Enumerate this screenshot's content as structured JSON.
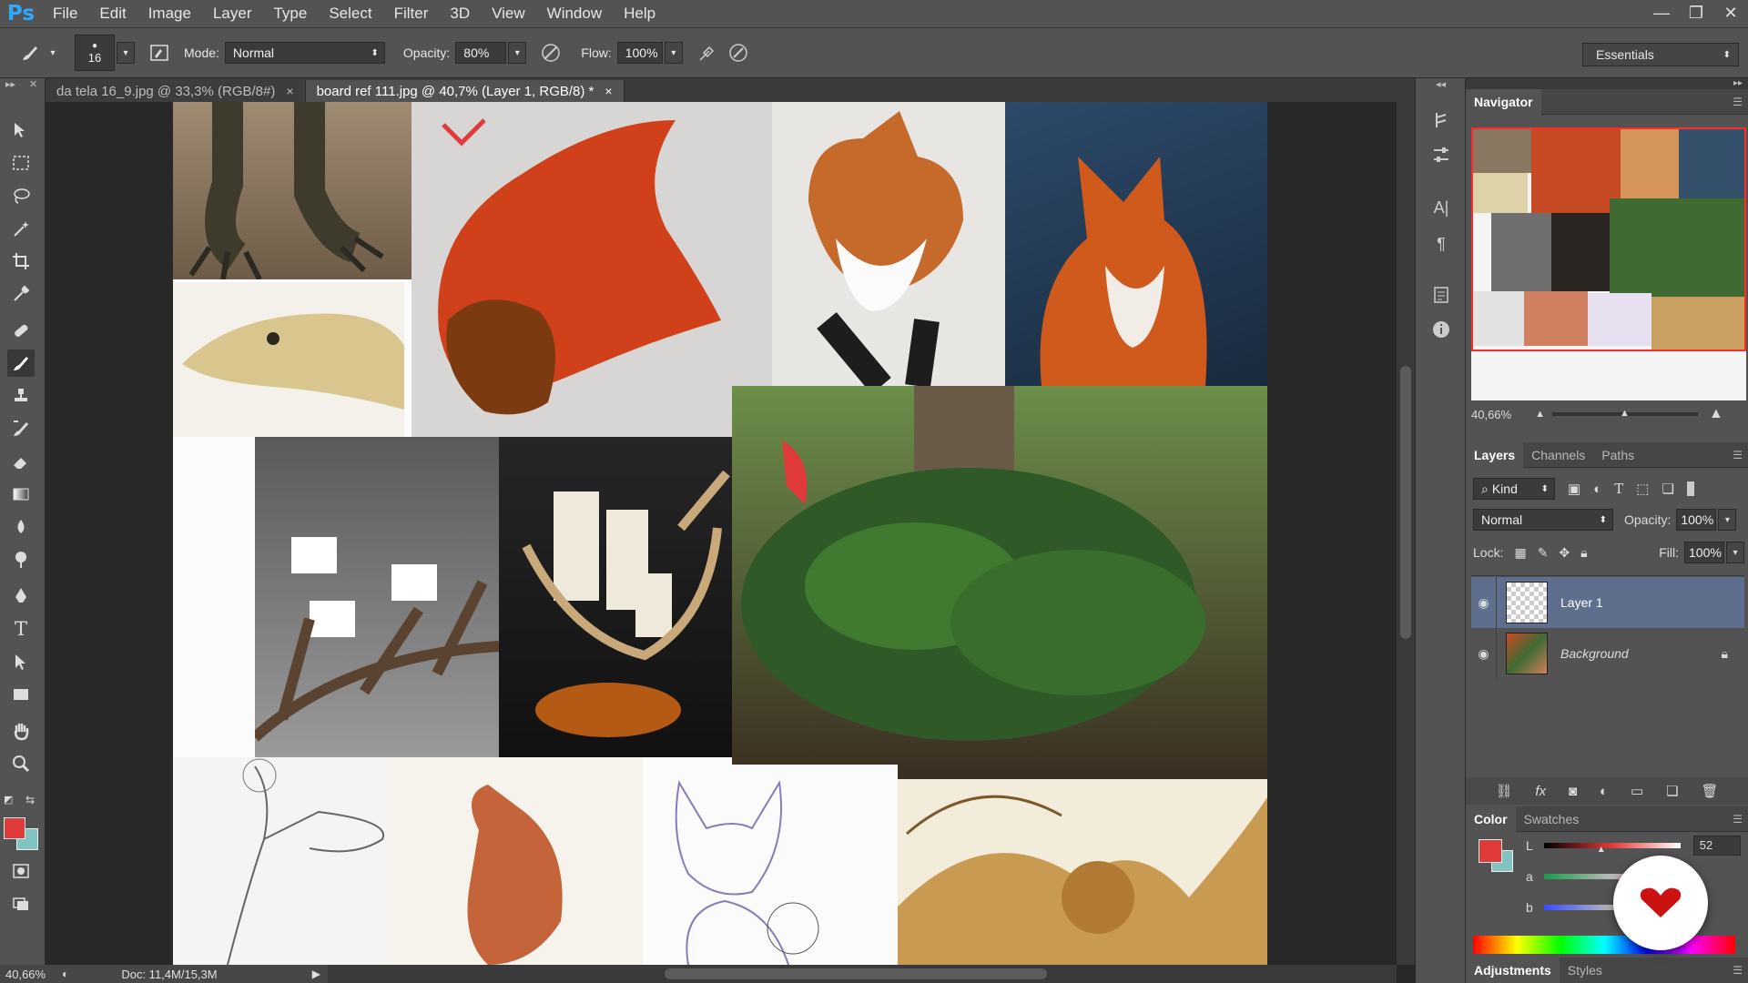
{
  "app": {
    "logo": "Ps"
  },
  "menu": [
    "File",
    "Edit",
    "Image",
    "Layer",
    "Type",
    "Select",
    "Filter",
    "3D",
    "View",
    "Window",
    "Help"
  ],
  "window_controls": [
    "—",
    "❐",
    "✕"
  ],
  "options": {
    "brush_size": "16",
    "mode_label": "Mode:",
    "mode_value": "Normal",
    "opacity_label": "Opacity:",
    "opacity_value": "80%",
    "flow_label": "Flow:",
    "flow_value": "100%",
    "workspace": "Essentials"
  },
  "tabs": [
    {
      "label": "da tela 16_9.jpg @ 33,3% (RGB/8#)",
      "close": "×"
    },
    {
      "label": "board ref 111.jpg @ 40,7% (Layer 1, RGB/8) *",
      "close": "×"
    }
  ],
  "status": {
    "zoom": "40,66%",
    "doc": "Doc: 11,4M/15,3M"
  },
  "navigator": {
    "title": "Navigator",
    "zoom": "40,66%"
  },
  "layers_panel": {
    "tabs": [
      "Layers",
      "Channels",
      "Paths"
    ],
    "kind": "Kind",
    "blend_mode": "Normal",
    "opacity_label": "Opacity:",
    "opacity_value": "100%",
    "lock_label": "Lock:",
    "fill_label": "Fill:",
    "fill_value": "100%",
    "layers": [
      {
        "name": "Layer 1",
        "selected": true
      },
      {
        "name": "Background",
        "selected": false,
        "locked": true
      }
    ]
  },
  "color_panel": {
    "tabs": [
      "Color",
      "Swatches"
    ],
    "L_label": "L",
    "L_value": "52",
    "a_label": "a",
    "b_label": "b",
    "foreground": "#e03a3a",
    "background": "#7fc4c0"
  },
  "bottom_tabs": [
    "Adjustments",
    "Styles"
  ]
}
